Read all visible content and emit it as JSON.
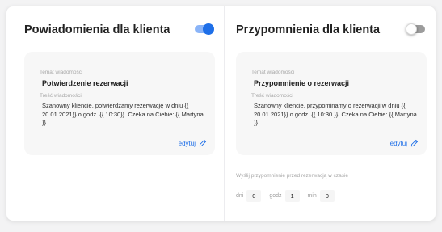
{
  "left": {
    "title": "Powiadomienia dla klienta",
    "toggle_on": true,
    "subject_label": "Temat wiadomości",
    "subject": "Potwierdzenie rezerwacji",
    "body_label": "Treść wiadomości",
    "body": "Szanowny kliencie, potwierdzamy rezerwację w dniu {{ 20.01.2021}} o godz. {{ 10:30}}. Czeka na Ciebie: {{ Martyna }}.",
    "edit_label": "edytuj"
  },
  "right": {
    "title": "Przypomnienia dla klienta",
    "toggle_on": false,
    "subject_label": "Temat wiadomości",
    "subject": "Przypomnienie o rezerwacji",
    "body_label": "Treść wiadomości",
    "body": "Szanowny kliencie, przypominamy o rezerwacji w dniu {{ 20.01.2021}} o godz. {{ 10:30 }}. Czeka na Ciebie: {{ Martyna }}.",
    "edit_label": "edytuj",
    "timing_label": "Wyślij przypomnienie przed rezerwacją w czasie",
    "days_label": "dni",
    "days_value": "0",
    "hours_label": "godz",
    "hours_value": "1",
    "minutes_label": "min",
    "minutes_value": "0"
  },
  "colors": {
    "accent": "#1e6fe8",
    "toggle_track_on": "#8ab4f8",
    "toggle_track_off": "#9c9c9c"
  },
  "icons": {
    "edit": "pencil-icon"
  }
}
